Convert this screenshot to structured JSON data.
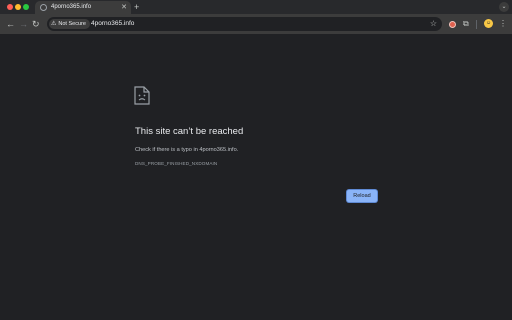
{
  "window": {
    "tab": {
      "title": "4porno365.info",
      "close_glyph": "✕"
    },
    "new_tab_glyph": "+",
    "tab_search_glyph": "⌄"
  },
  "toolbar": {
    "back_glyph": "←",
    "forward_glyph": "→",
    "reload_glyph": "↻",
    "security_chip": "Not Secure",
    "security_icon_glyph": "⚠",
    "url": "4porno365.info",
    "bookmark_glyph": "☆",
    "extensions_glyph": "⧉",
    "menu_glyph": "⋮",
    "avatar_glyph": "☺"
  },
  "error_page": {
    "icon": "sad-document-icon",
    "title": "This site can’t be reached",
    "description": "Check if there is a typo in 4porno365.info.",
    "error_code": "DNS_PROBE_FINISHED_NXDOMAIN",
    "reload_label": "Reload"
  },
  "colors": {
    "page_bg": "#202124",
    "toolbar_bg": "#3c3c3c",
    "tabstrip_bg": "#28292c",
    "accent": "#8ab4f8"
  }
}
